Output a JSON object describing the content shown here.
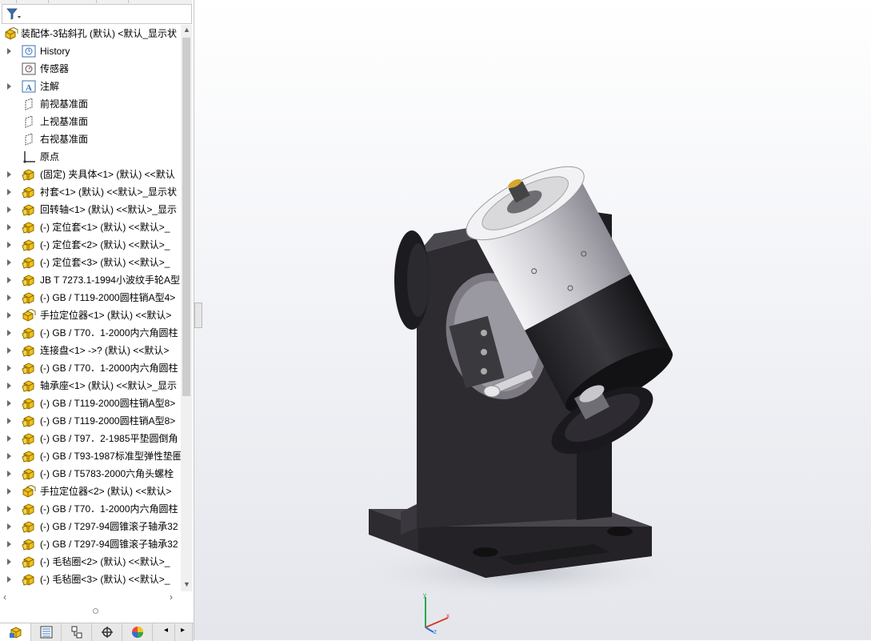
{
  "feature_tree": {
    "root": "装配体-3钻斜孔 (默认) <默认_显示状",
    "items": [
      {
        "label": "History",
        "icon": "history-icon",
        "expand": true
      },
      {
        "label": "传感器",
        "icon": "sensor-icon",
        "expand": false
      },
      {
        "label": "注解",
        "icon": "annotation-icon",
        "expand": true
      },
      {
        "label": "前视基准面",
        "icon": "plane-icon",
        "expand": false
      },
      {
        "label": "上视基准面",
        "icon": "plane-icon",
        "expand": false
      },
      {
        "label": "右视基准面",
        "icon": "plane-icon",
        "expand": false
      },
      {
        "label": "原点",
        "icon": "origin-icon",
        "expand": false
      },
      {
        "label": "(固定) 夹具体<1> (默认) <<默认",
        "icon": "part-icon",
        "expand": true
      },
      {
        "label": "衬套<1> (默认) <<默认>_显示状",
        "icon": "part-icon",
        "expand": true
      },
      {
        "label": "回转轴<1> (默认) <<默认>_显示",
        "icon": "part-icon",
        "expand": true
      },
      {
        "label": "(-) 定位套<1> (默认) <<默认>_",
        "icon": "part-icon",
        "expand": true
      },
      {
        "label": "(-) 定位套<2> (默认) <<默认>_",
        "icon": "part-icon",
        "expand": true
      },
      {
        "label": "(-) 定位套<3> (默认) <<默认>_",
        "icon": "part-icon",
        "expand": true
      },
      {
        "label": "JB T 7273.1-1994小波纹手轮A型",
        "icon": "part-icon",
        "expand": true
      },
      {
        "label": "(-) GB / T119-2000圆柱销A型4>",
        "icon": "part-icon",
        "expand": true
      },
      {
        "label": "手拉定位器<1> (默认) <<默认>",
        "icon": "assembly-icon",
        "expand": true
      },
      {
        "label": "(-) GB / T70．1-2000内六角圆柱",
        "icon": "part-icon",
        "expand": true
      },
      {
        "label": "连接盘<1> ->? (默认) <<默认>",
        "icon": "part-icon",
        "expand": true
      },
      {
        "label": "(-) GB / T70．1-2000内六角圆柱",
        "icon": "part-icon",
        "expand": true
      },
      {
        "label": "轴承座<1> (默认) <<默认>_显示",
        "icon": "part-icon",
        "expand": true
      },
      {
        "label": "(-) GB / T119-2000圆柱销A型8>",
        "icon": "part-icon",
        "expand": true
      },
      {
        "label": "(-) GB / T119-2000圆柱销A型8>",
        "icon": "part-icon",
        "expand": true
      },
      {
        "label": "(-) GB / T97．2-1985平垫圆倒角",
        "icon": "part-icon",
        "expand": true
      },
      {
        "label": "(-) GB / T93-1987标准型弹性垫圈",
        "icon": "part-icon",
        "expand": true
      },
      {
        "label": "(-) GB / T5783-2000六角头螺栓",
        "icon": "part-icon",
        "expand": true
      },
      {
        "label": "手拉定位器<2> (默认) <<默认>",
        "icon": "assembly-icon",
        "expand": true
      },
      {
        "label": "(-) GB / T70．1-2000内六角圆柱",
        "icon": "part-icon",
        "expand": true
      },
      {
        "label": "(-) GB / T297-94圆锥滚子轴承32",
        "icon": "part-icon",
        "expand": true
      },
      {
        "label": "(-) GB / T297-94圆锥滚子轴承32",
        "icon": "part-icon",
        "expand": true
      },
      {
        "label": "(-) 毛毡圈<2> (默认) <<默认>_",
        "icon": "part-icon",
        "expand": true
      },
      {
        "label": "(-) 毛毡圈<3> (默认) <<默认>_",
        "icon": "part-icon",
        "expand": true
      }
    ]
  },
  "bottom_tabs": [
    "feature-manager-tab",
    "property-manager-tab",
    "configuration-manager-tab",
    "dimxpert-tab",
    "display-manager-tab"
  ],
  "triad": {
    "x": "x",
    "y": "y",
    "z": "z"
  },
  "colors": {
    "part_icon": "#f2c018",
    "part_icon_border": "#9a7a00",
    "base_dark": "#2d2b2f",
    "cylinder_light": "#d8d8dc"
  }
}
